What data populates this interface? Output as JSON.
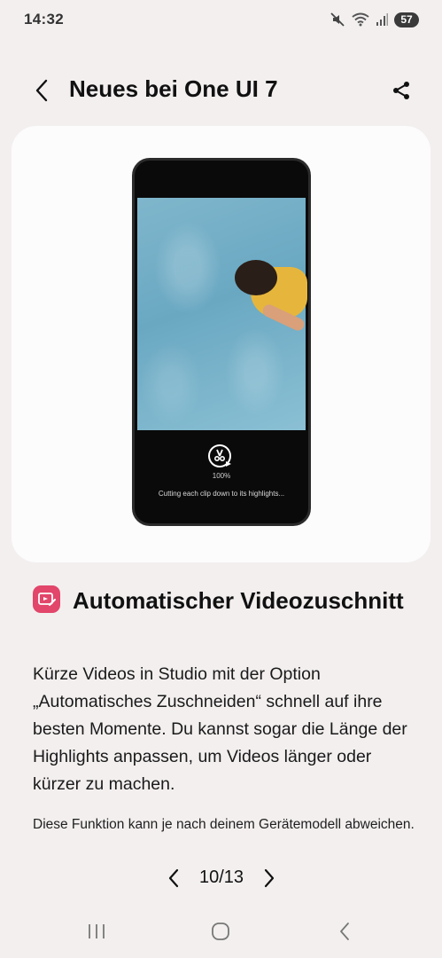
{
  "status_bar": {
    "time": "14:32",
    "battery": "57",
    "icons": [
      "mute-icon",
      "wifi-icon",
      "signal-icon",
      "battery-icon"
    ]
  },
  "header": {
    "title": "Neues bei One UI 7",
    "back_icon": "chevron-left-icon",
    "share_icon": "share-icon"
  },
  "illustration": {
    "progress": "100%",
    "caption": "Cutting each clip down to its highlights..."
  },
  "feature": {
    "icon": "video-trim-app-icon",
    "icon_color": "#e2466a",
    "title": "Automatischer Videozuschnitt",
    "description": "Kürze Videos in Studio mit der Option „Automatisches Zuschneiden“ schnell auf ihre besten Momente. Du kannst sogar die Länge der Highlights anpassen, um Videos länger oder kürzer zu machen.",
    "note": "Diese Funktion kann je nach deinem Gerätemodell abweichen."
  },
  "pager": {
    "label": "10/13"
  },
  "nav_bar": {
    "recent_icon": "recent-apps-icon",
    "home_icon": "home-icon",
    "back_icon": "back-icon"
  }
}
